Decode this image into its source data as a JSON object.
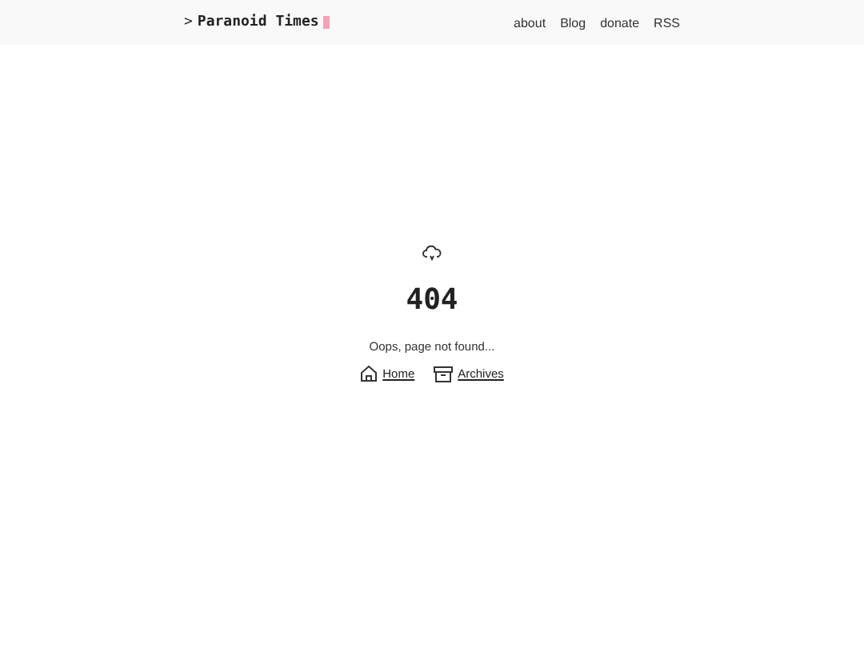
{
  "header": {
    "prompt": ">",
    "title": "Paranoid Times",
    "nav": [
      "about",
      "Blog",
      "donate",
      "RSS"
    ]
  },
  "error": {
    "code": "404",
    "message": "Oops, page not found...",
    "links": [
      {
        "kind": "home",
        "label": "Home"
      },
      {
        "kind": "archive",
        "label": "Archives"
      }
    ]
  }
}
